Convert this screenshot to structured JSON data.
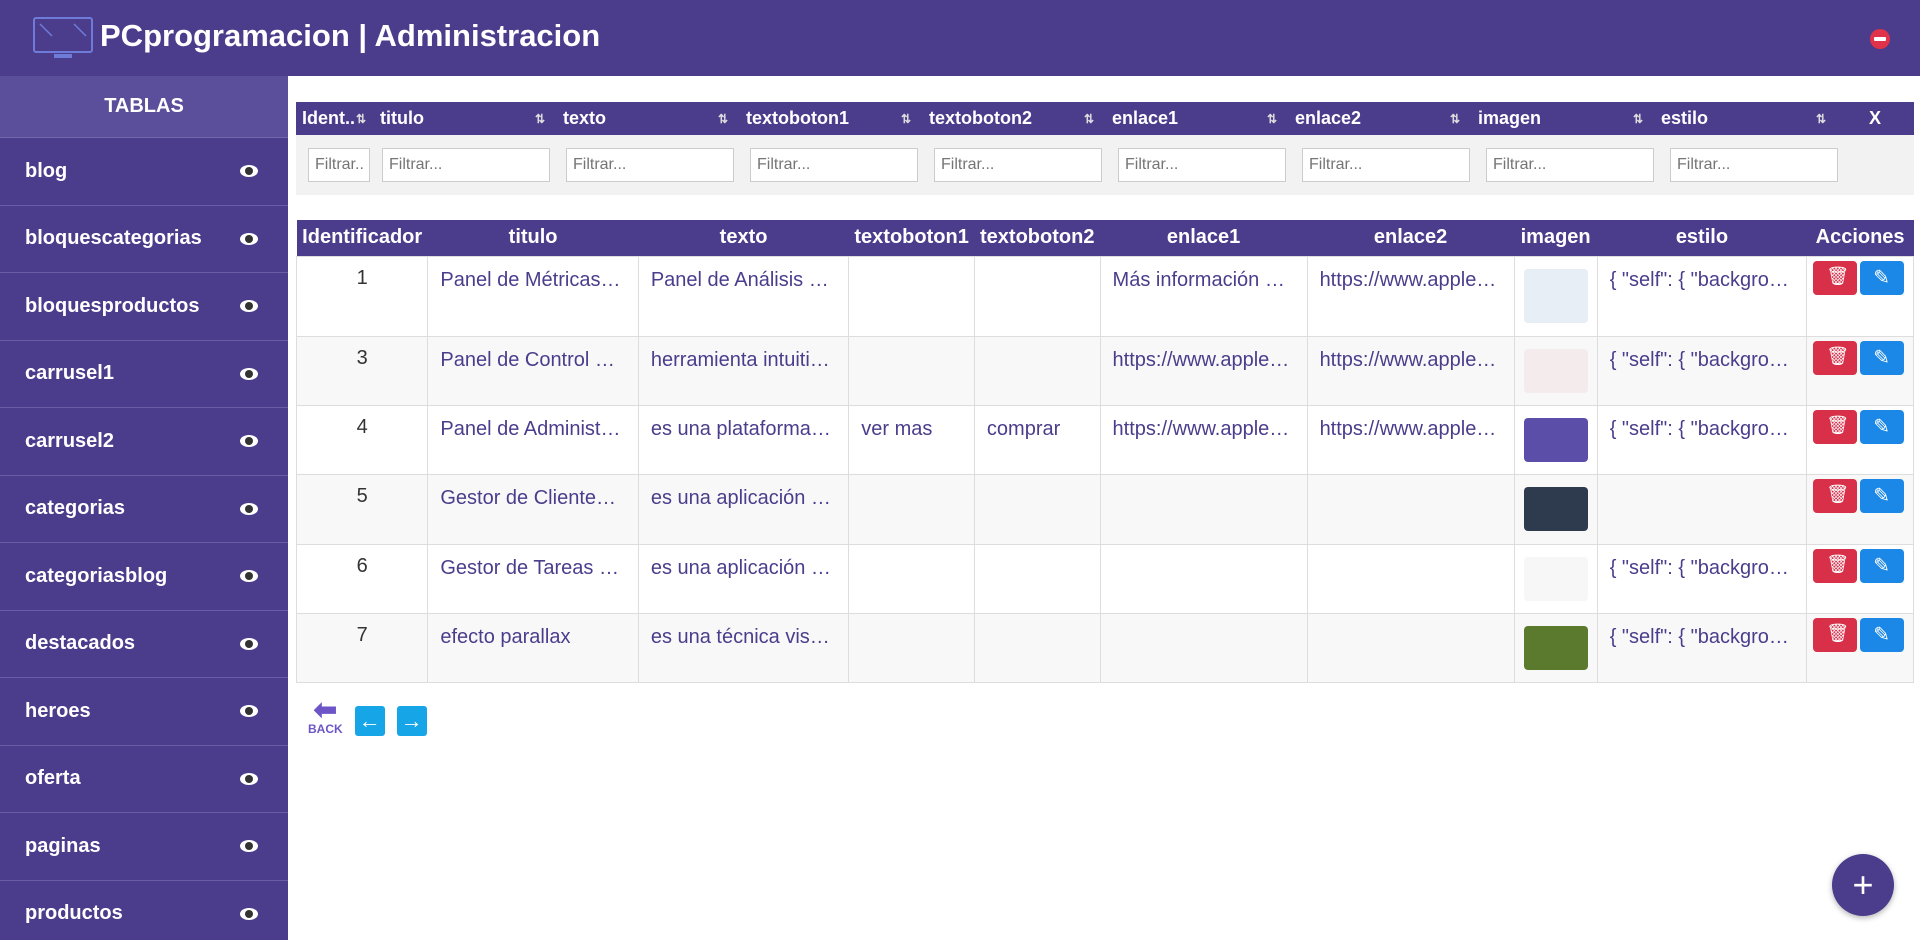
{
  "header": {
    "title": "PCprogramacion | Administracion"
  },
  "sidebar": {
    "title": "TABLAS",
    "items": [
      {
        "label": "blog"
      },
      {
        "label": "bloquescategorias"
      },
      {
        "label": "bloquesproductos"
      },
      {
        "label": "carrusel1"
      },
      {
        "label": "carrusel2"
      },
      {
        "label": "categorias"
      },
      {
        "label": "categoriasblog"
      },
      {
        "label": "destacados"
      },
      {
        "label": "heroes"
      },
      {
        "label": "oferta"
      },
      {
        "label": "paginas"
      },
      {
        "label": "productos"
      }
    ]
  },
  "filters": {
    "headers": [
      "Ident..",
      "titulo",
      "texto",
      "textoboton1",
      "textoboton2",
      "enlace1",
      "enlace2",
      "imagen",
      "estilo"
    ],
    "placeholder": "Filtrar...",
    "clear_label": "X"
  },
  "table": {
    "headers": [
      "Identificador",
      "titulo",
      "texto",
      "textoboton1",
      "textoboton2",
      "enlace1",
      "enlace2",
      "imagen",
      "estilo",
      "Acciones"
    ],
    "rows": [
      {
        "id": "1",
        "titulo": "Panel de Métricas…",
        "texto": "Panel de Análisis …",
        "textoboton1": "",
        "textoboton2": "",
        "enlace1": "Más información …",
        "enlace2": "https://www.apple…",
        "thumb_color": "#e8eef6",
        "estilo": "{ \"self\": { \"backgro…"
      },
      {
        "id": "3",
        "titulo": "Panel de Control …",
        "texto": "herramienta intuiti…",
        "textoboton1": "",
        "textoboton2": "",
        "enlace1": "https://www.apple…",
        "enlace2": "https://www.apple…",
        "thumb_color": "#f4ecec",
        "estilo": "{ \"self\": { \"backgro…"
      },
      {
        "id": "4",
        "titulo": "Panel de Administ…",
        "texto": "es una plataforma…",
        "textoboton1": "ver mas",
        "textoboton2": "comprar",
        "enlace1": "https://www.apple…",
        "enlace2": "https://www.apple…",
        "thumb_color": "#5a4ea8",
        "estilo": "{ \"self\": { \"backgro…"
      },
      {
        "id": "5",
        "titulo": "Gestor de Cliente…",
        "texto": "es una aplicación …",
        "textoboton1": "",
        "textoboton2": "",
        "enlace1": "",
        "enlace2": "",
        "thumb_color": "#2e3b4e",
        "estilo": ""
      },
      {
        "id": "6",
        "titulo": "Gestor de Tareas …",
        "texto": "es una aplicación …",
        "textoboton1": "",
        "textoboton2": "",
        "enlace1": "",
        "enlace2": "",
        "thumb_color": "#f7f7f7",
        "estilo": "{ \"self\": { \"backgro…"
      },
      {
        "id": "7",
        "titulo": "efecto parallax",
        "texto": "es una técnica vis…",
        "textoboton1": "",
        "textoboton2": "",
        "enlace1": "",
        "enlace2": "",
        "thumb_color": "#5b7a2e",
        "estilo": "{ \"self\": { \"backgro…"
      }
    ]
  },
  "pager": {
    "back_label": "BACK",
    "prev_symbol": "🡐",
    "next_symbol": "🡒"
  },
  "fab": {
    "symbol": "+"
  }
}
